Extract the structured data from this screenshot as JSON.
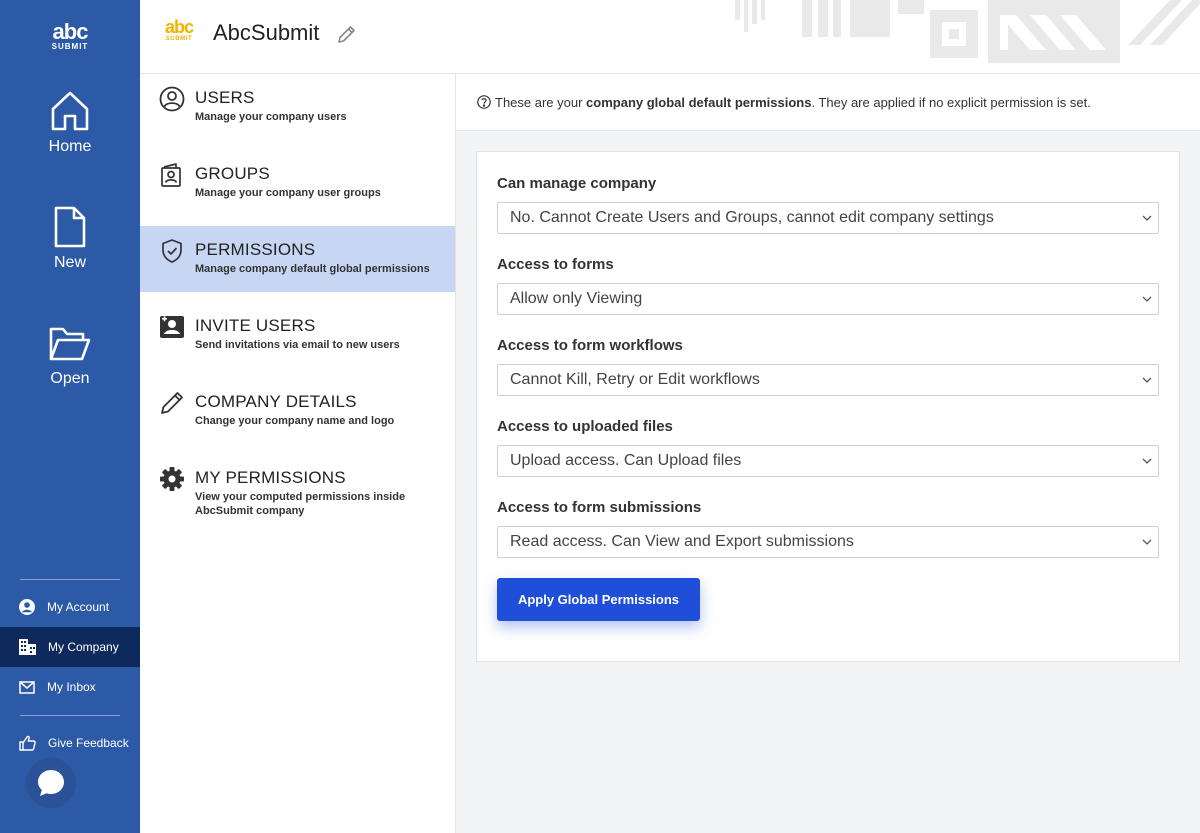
{
  "rail": {
    "logo_text": "abc",
    "logo_sub": "SUBMIT",
    "home": "Home",
    "new": "New",
    "open": "Open",
    "links": {
      "account": "My Account",
      "company": "My Company",
      "inbox": "My Inbox",
      "feedback": "Give Feedback"
    }
  },
  "header": {
    "logo_text": "abc",
    "logo_sub": "SUBMIT",
    "company_name": "AbcSubmit"
  },
  "menu": {
    "items": [
      {
        "title": "USERS",
        "desc": "Manage your company users"
      },
      {
        "title": "GROUPS",
        "desc": "Manage your company user groups"
      },
      {
        "title": "PERMISSIONS",
        "desc": "Manage company default global permissions"
      },
      {
        "title": "INVITE USERS",
        "desc": "Send invitations via email to new users"
      },
      {
        "title": "COMPANY DETAILS",
        "desc": "Change your company name and logo"
      },
      {
        "title": "MY PERMISSIONS",
        "desc": "View your computed permissions inside AbcSubmit company"
      }
    ]
  },
  "info": {
    "prefix": "These are your ",
    "bold": "company global default permissions",
    "suffix": ". They are applied if no explicit permission is set."
  },
  "form": {
    "fields": [
      {
        "label": "Can manage company",
        "value": "No. Cannot Create Users and Groups, cannot edit company settings"
      },
      {
        "label": "Access to forms",
        "value": "Allow only Viewing"
      },
      {
        "label": "Access to form workflows",
        "value": "Cannot Kill, Retry or Edit workflows"
      },
      {
        "label": "Access to uploaded files",
        "value": "Upload access. Can Upload files"
      },
      {
        "label": "Access to form submissions",
        "value": "Read access. Can View and Export submissions"
      }
    ],
    "apply_label": "Apply Global Permissions"
  },
  "colors": {
    "rail": "#2d5aa6",
    "rail_active": "#0e2a5c",
    "menu_active": "#c6d6f3",
    "button": "#1f4fd8",
    "brand_yellow": "#f0b400"
  }
}
